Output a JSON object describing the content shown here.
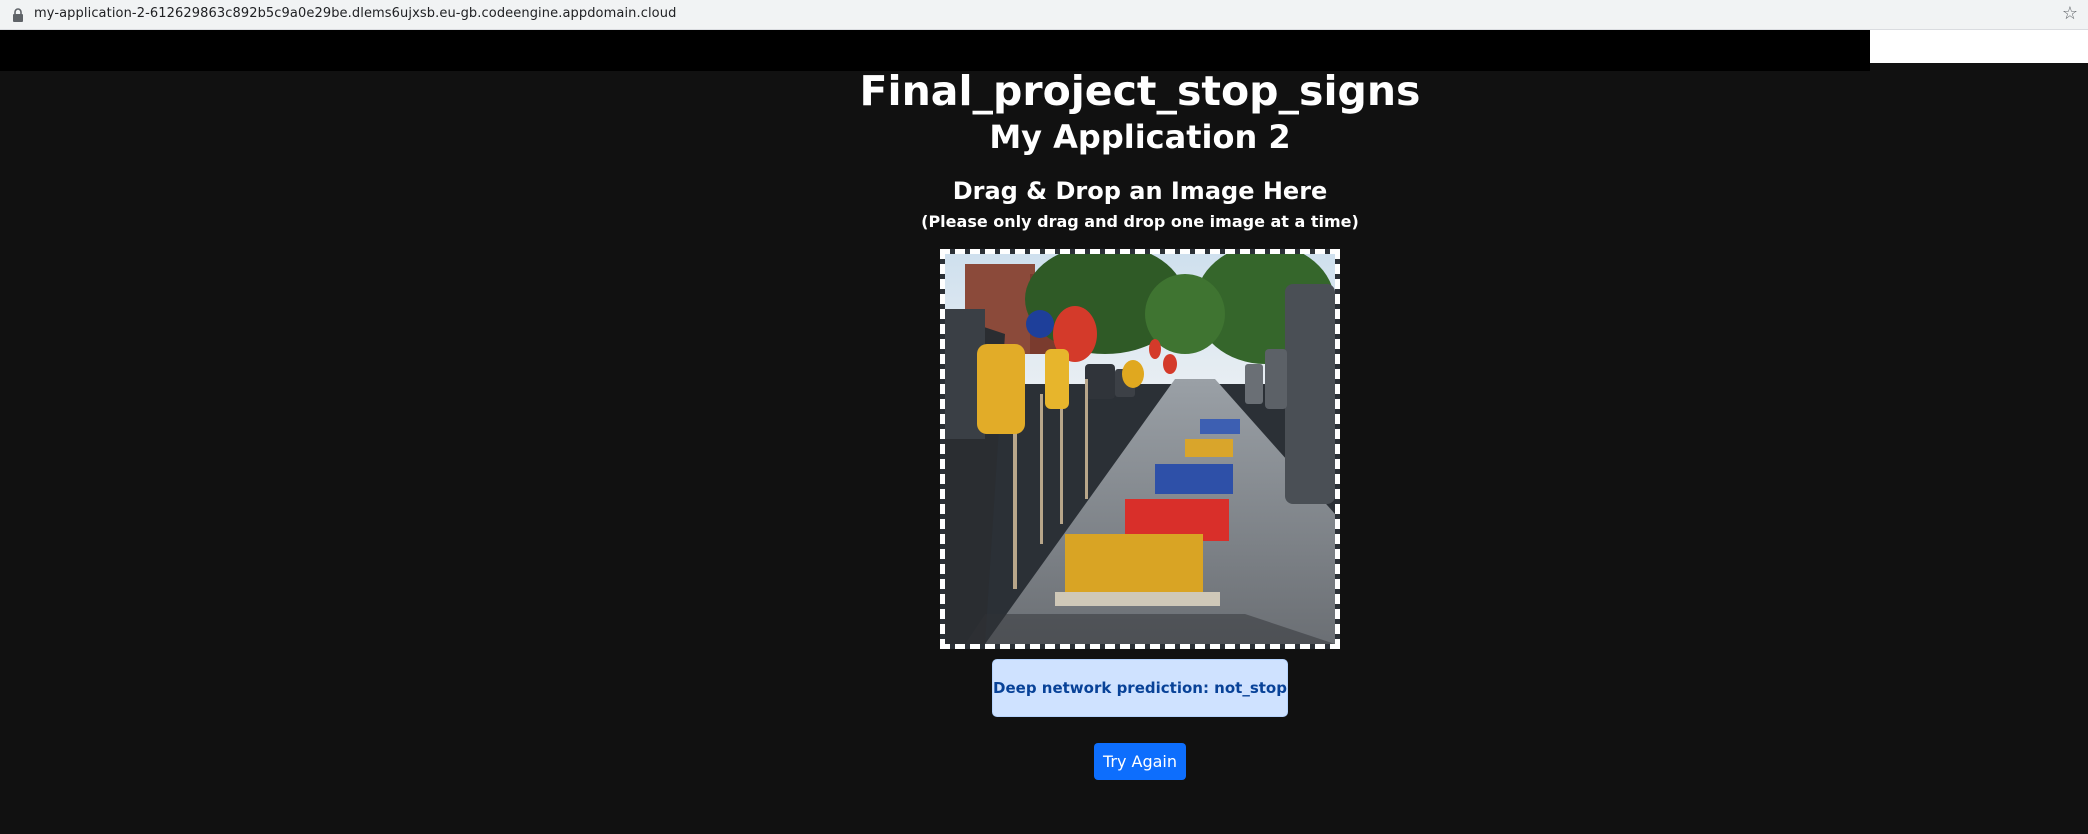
{
  "browser": {
    "url": "my-application-2-612629863c892b5c9a0e29be.dlems6ujxsb.eu-gb.codeengine.appdomain.cloud",
    "lock_icon": "lock-icon",
    "bookmark_icon": "star-icon"
  },
  "header": {
    "title": "Final_project_stop_signs",
    "subtitle": "My Application 2"
  },
  "upload": {
    "heading": "Drag & Drop an Image Here",
    "note": "(Please only drag and drop one image at a time)"
  },
  "result": {
    "prediction_text": "Deep network prediction: not_stop"
  },
  "actions": {
    "try_again_label": "Try Again"
  },
  "colors": {
    "background": "#111111",
    "prediction_bg": "#cfe2ff",
    "prediction_text": "#084298",
    "button": "#0d6efd"
  }
}
